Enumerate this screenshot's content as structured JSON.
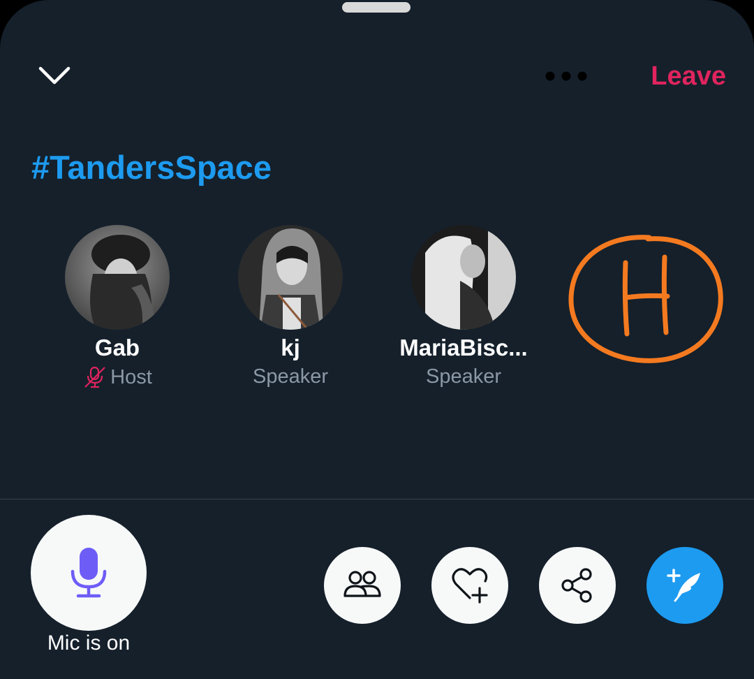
{
  "header": {
    "leave_label": "Leave"
  },
  "space": {
    "title": "#TandersSpace"
  },
  "participants": [
    {
      "name": "Gab",
      "role": "Host",
      "muted": true
    },
    {
      "name": "kj",
      "role": "Speaker",
      "muted": false
    },
    {
      "name": "MariaBisc...",
      "role": "Speaker",
      "muted": false
    }
  ],
  "annotation": {
    "letter": "H",
    "color": "#f47a20"
  },
  "footer": {
    "mic_status": "Mic is on"
  },
  "icons": {
    "collapse": "chevron-down-icon",
    "more": "more-horizontal-icon",
    "mic_off": "mic-off-icon",
    "mic": "microphone-icon",
    "people": "people-icon",
    "reaction": "heart-plus-icon",
    "share": "share-icon",
    "compose": "compose-tweet-icon"
  },
  "colors": {
    "background": "#15202b",
    "accent": "#1d9bf0",
    "leave": "#e0245e",
    "mic": "#6e5cf7",
    "secondary_text": "#8b98a5"
  }
}
